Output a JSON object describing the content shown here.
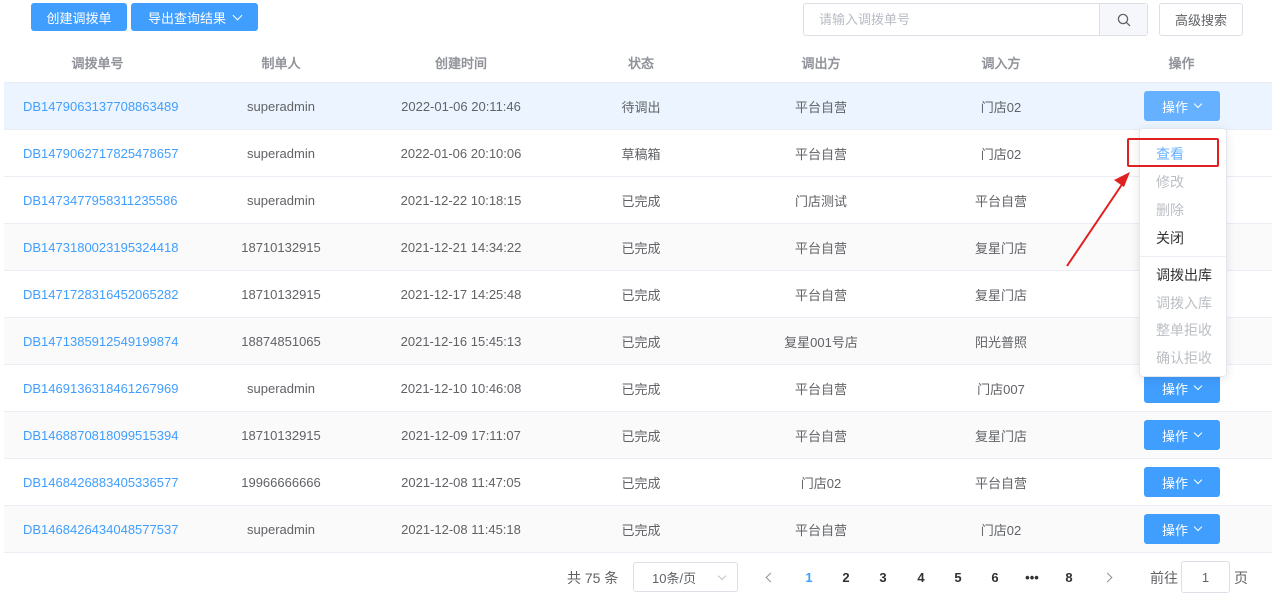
{
  "toolbar": {
    "create_label": "创建调拨单",
    "export_label": "导出查询结果",
    "search_placeholder": "请输入调拨单号",
    "advanced_label": "高级搜索"
  },
  "columns": [
    "调拨单号",
    "制单人",
    "创建时间",
    "状态",
    "调出方",
    "调入方",
    "操作"
  ],
  "rows": [
    {
      "no": "DB1479063137708863489",
      "maker": "superadmin",
      "time": "2022-01-06 20:11:46",
      "status": "待调出",
      "from": "平台自营",
      "to": "门店02",
      "op": "操作"
    },
    {
      "no": "DB1479062717825478657",
      "maker": "superadmin",
      "time": "2022-01-06 20:10:06",
      "status": "草稿箱",
      "from": "平台自营",
      "to": "门店02",
      "op": ""
    },
    {
      "no": "DB1473477958311235586",
      "maker": "superadmin",
      "time": "2021-12-22 10:18:15",
      "status": "已完成",
      "from": "门店测试",
      "to": "平台自营",
      "op": ""
    },
    {
      "no": "DB1473180023195324418",
      "maker": "18710132915",
      "time": "2021-12-21 14:34:22",
      "status": "已完成",
      "from": "平台自营",
      "to": "复星门店",
      "op": ""
    },
    {
      "no": "DB1471728316452065282",
      "maker": "18710132915",
      "time": "2021-12-17 14:25:48",
      "status": "已完成",
      "from": "平台自营",
      "to": "复星门店",
      "op": ""
    },
    {
      "no": "DB1471385912549199874",
      "maker": "18874851065",
      "time": "2021-12-16 15:45:13",
      "status": "已完成",
      "from": "复星001号店",
      "to": "阳光普照",
      "op": ""
    },
    {
      "no": "DB1469136318461267969",
      "maker": "superadmin",
      "time": "2021-12-10 10:46:08",
      "status": "已完成",
      "from": "平台自营",
      "to": "门店007",
      "op": "操作"
    },
    {
      "no": "DB1468870818099515394",
      "maker": "18710132915",
      "time": "2021-12-09 17:11:07",
      "status": "已完成",
      "from": "平台自营",
      "to": "复星门店",
      "op": "操作"
    },
    {
      "no": "DB1468426883405336577",
      "maker": "19966666666",
      "time": "2021-12-08 11:47:05",
      "status": "已完成",
      "from": "门店02",
      "to": "平台自营",
      "op": "操作"
    },
    {
      "no": "DB1468426434048577537",
      "maker": "superadmin",
      "time": "2021-12-08 11:45:18",
      "status": "已完成",
      "from": "平台自营",
      "to": "门店02",
      "op": "操作"
    }
  ],
  "dropdown": {
    "items": [
      {
        "label": "查看",
        "state": "selected"
      },
      {
        "label": "修改",
        "state": "disabled"
      },
      {
        "label": "删除",
        "state": "disabled"
      },
      {
        "label": "关闭",
        "state": "enabled"
      },
      {
        "label": "调拨出库",
        "state": "enabled"
      },
      {
        "label": "调拨入库",
        "state": "disabled"
      },
      {
        "label": "整单拒收",
        "state": "disabled"
      },
      {
        "label": "确认拒收",
        "state": "disabled"
      }
    ]
  },
  "pagination": {
    "total": "共 75 条",
    "page_size": "10条/页",
    "pages": [
      "1",
      "2",
      "3",
      "4",
      "5",
      "6",
      "•••",
      "8"
    ],
    "current": "1",
    "goto_prefix": "前往",
    "goto_value": "1",
    "goto_suffix": "页"
  },
  "colors": {
    "primary": "#409eff",
    "link": "#409eff",
    "highlight_row": "#ecf5ff",
    "annotation_red": "#e02020"
  }
}
